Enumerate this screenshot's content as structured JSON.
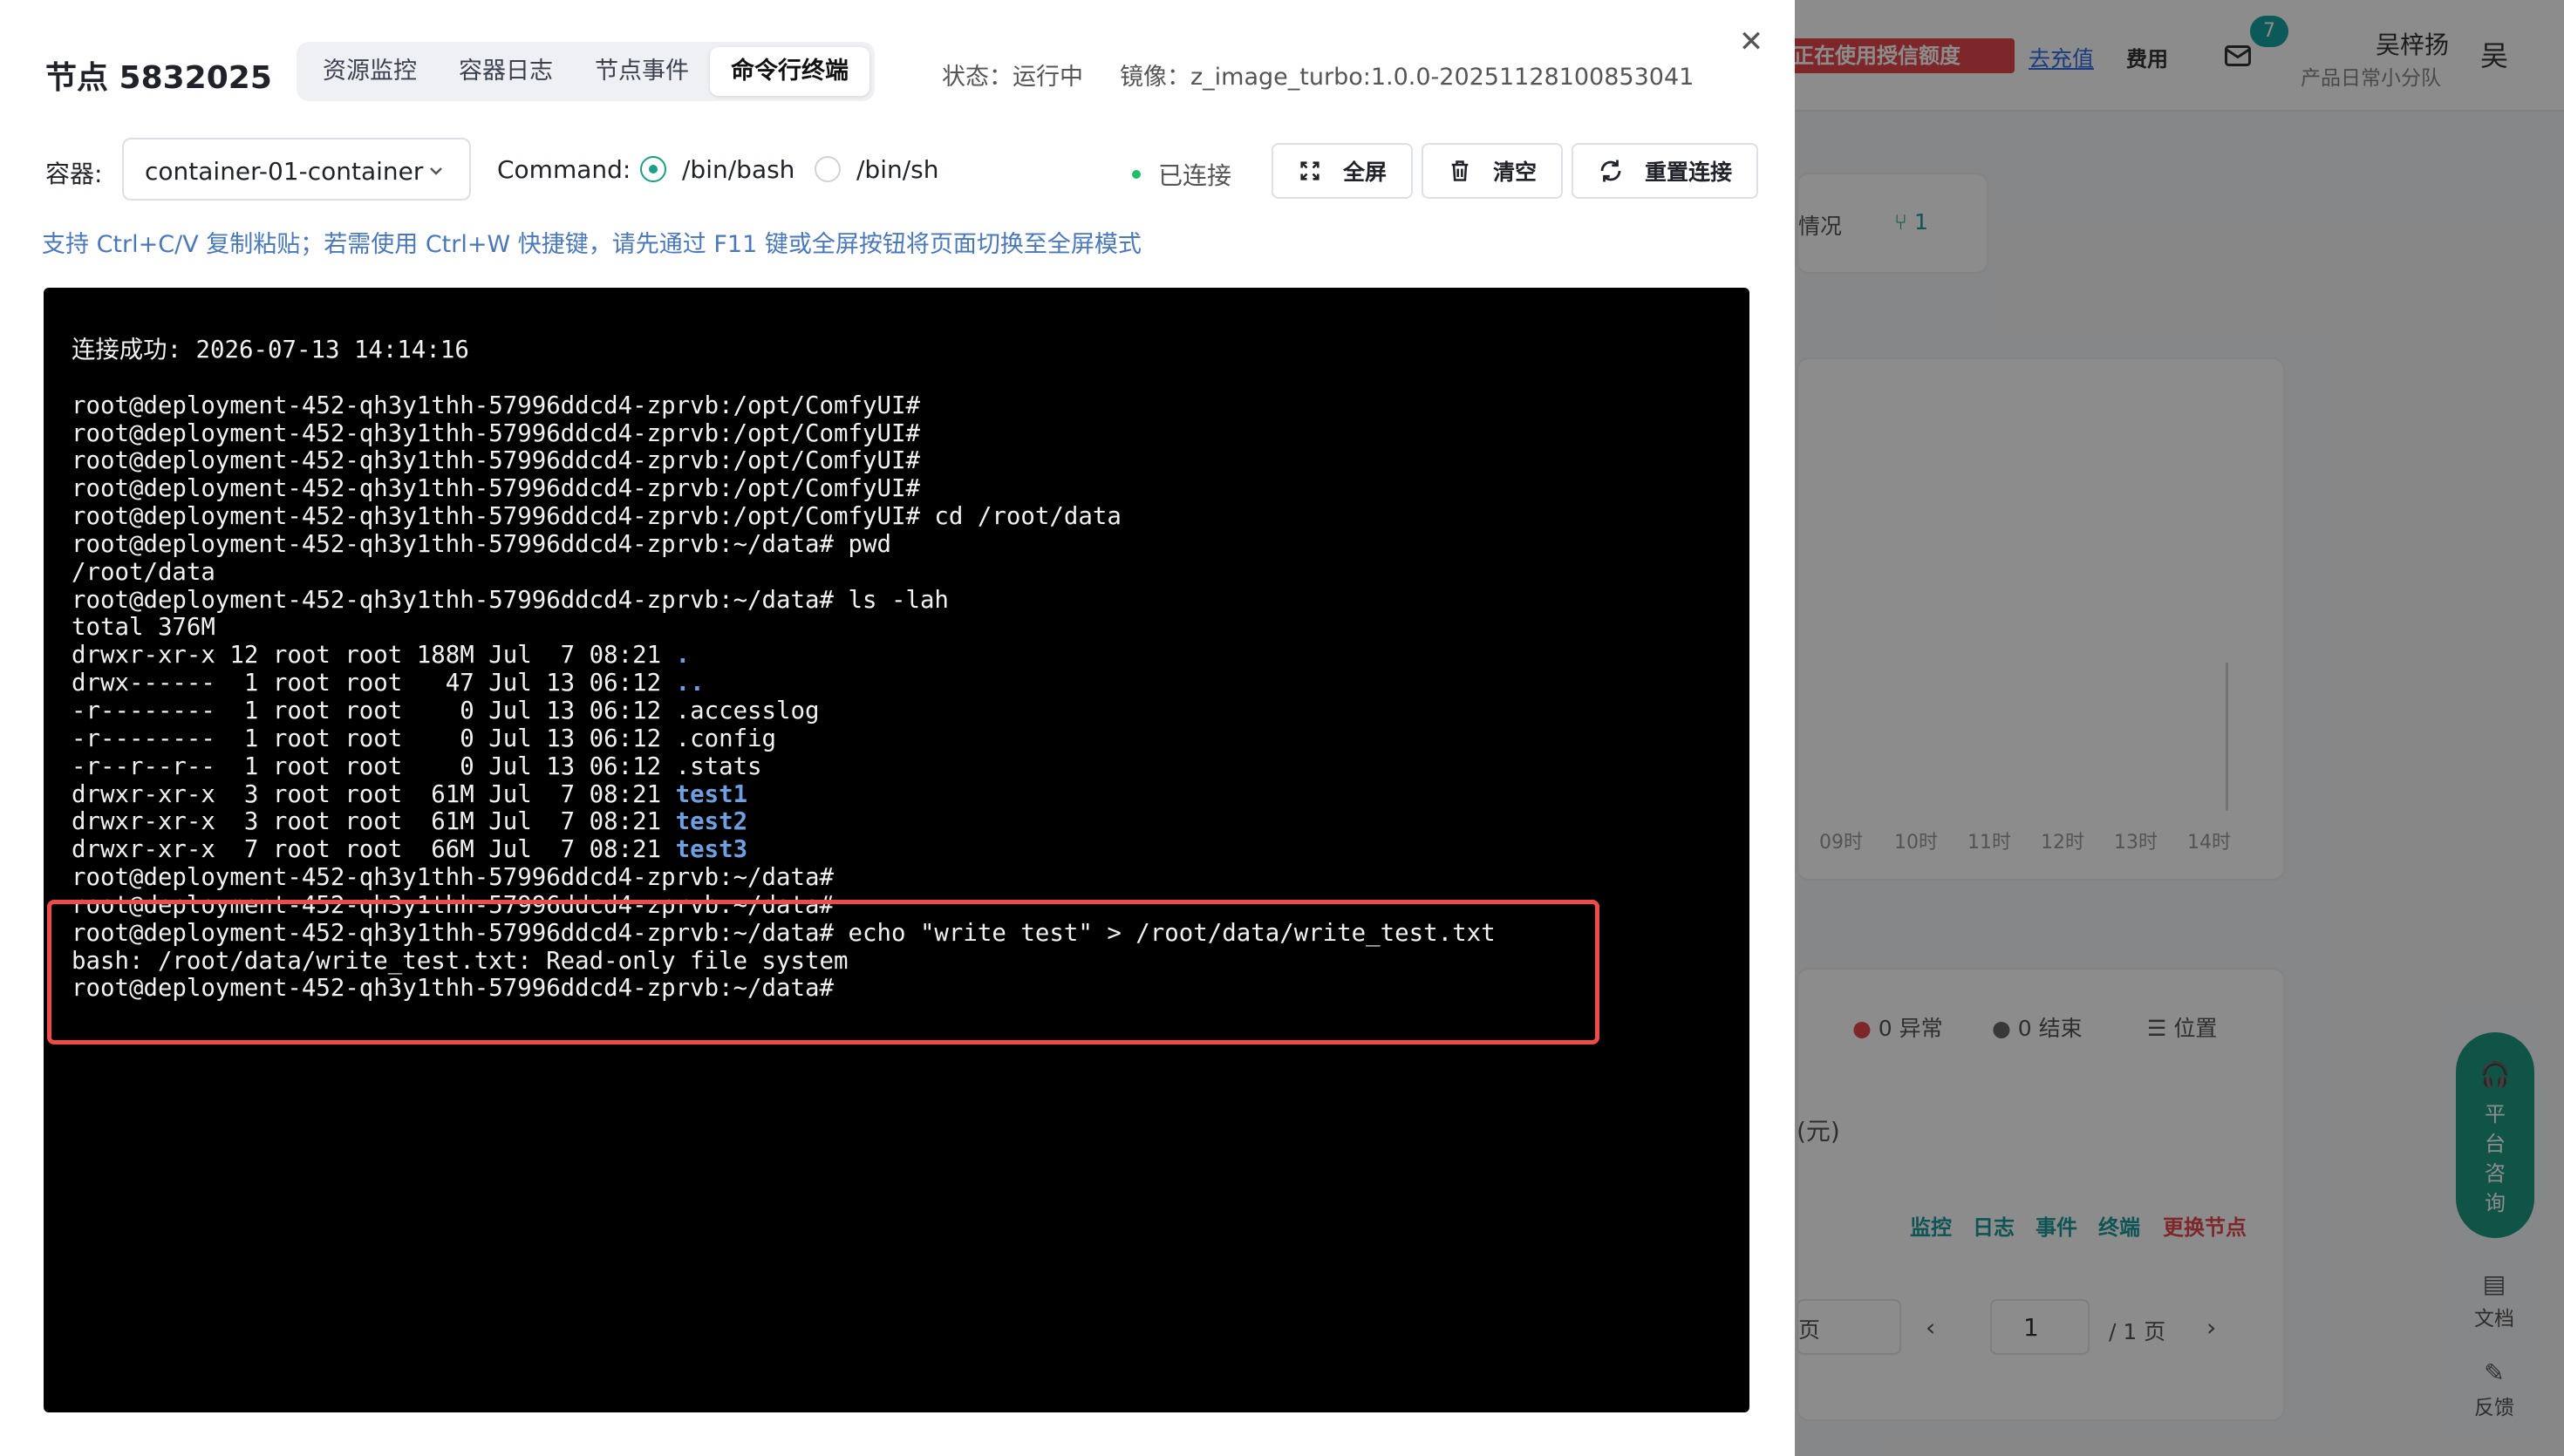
{
  "background": {
    "quota_banner": "正在使用授信额度",
    "recharge_link": "去充值",
    "fee_label": "费用",
    "mail_badge": "7",
    "user_name": "吴梓扬",
    "team_name": "产品日常小分队",
    "avatar_char": "吴",
    "card_overview": "情况",
    "card_count": "1",
    "chart_ticks": [
      "09时",
      "10时",
      "11时",
      "12时",
      "13时",
      "14时"
    ],
    "chip_abnormal": "0 异常",
    "chip_ended": "0 结束",
    "chip_position": "位置",
    "unit_yuan": "(元)",
    "row_links": [
      "监控",
      "日志",
      "事件",
      "终端"
    ],
    "row_link_danger": "更换节点",
    "pager_page": "1",
    "pager_total": "/ 1 页",
    "pager_size": "页",
    "consult": "平台咨询",
    "docs": "文档",
    "feedback": "反馈"
  },
  "drawer": {
    "title": "节点 5832025",
    "tabs": [
      {
        "label": "资源监控"
      },
      {
        "label": "容器日志"
      },
      {
        "label": "节点事件"
      },
      {
        "label": "命令行终端"
      }
    ],
    "active_tab": "命令行终端",
    "status": "状态：运行中",
    "image": "镜像：z_image_turbo:1.0.0-20251128100853041",
    "container_label": "容器:",
    "container_value": "container-01-container",
    "command_label": "Command:",
    "shell_options": [
      {
        "label": "/bin/bash",
        "selected": true
      },
      {
        "label": "/bin/sh",
        "selected": false
      }
    ],
    "connection": "已连接",
    "buttons": {
      "fullscreen": "全屏",
      "clear": "清空",
      "reconnect": "重置连接"
    },
    "hint": "支持 Ctrl+C/V 复制粘贴；若需使用 Ctrl+W 快捷键，请先通过 F11 键或全屏按钮将页面切换至全屏模式",
    "accent_color": "#1a9e8a",
    "highlight_color": "#ee4b4b"
  },
  "terminal": {
    "lines": [
      {
        "text": "连接成功: 2026-07-13 14:14:16"
      },
      {
        "text": ""
      },
      {
        "text": "root@deployment-452-qh3y1thh-57996ddcd4-zprvb:/opt/ComfyUI#"
      },
      {
        "text": "root@deployment-452-qh3y1thh-57996ddcd4-zprvb:/opt/ComfyUI#"
      },
      {
        "text": "root@deployment-452-qh3y1thh-57996ddcd4-zprvb:/opt/ComfyUI#"
      },
      {
        "text": "root@deployment-452-qh3y1thh-57996ddcd4-zprvb:/opt/ComfyUI#"
      },
      {
        "text": "root@deployment-452-qh3y1thh-57996ddcd4-zprvb:/opt/ComfyUI# cd /root/data"
      },
      {
        "text": "root@deployment-452-qh3y1thh-57996ddcd4-zprvb:~/data# pwd"
      },
      {
        "text": "/root/data"
      },
      {
        "text": "root@deployment-452-qh3y1thh-57996ddcd4-zprvb:~/data# ls -lah"
      },
      {
        "text": "total 376M"
      },
      {
        "text": "drwxr-xr-x 12 root root 188M Jul  7 08:21 ",
        "dir": "."
      },
      {
        "text": "drwx------  1 root root   47 Jul 13 06:12 ",
        "dir": ".."
      },
      {
        "text": "-r--------  1 root root    0 Jul 13 06:12 .accesslog"
      },
      {
        "text": "-r--------  1 root root    0 Jul 13 06:12 .config"
      },
      {
        "text": "-r--r--r--  1 root root    0 Jul 13 06:12 .stats"
      },
      {
        "text": "drwxr-xr-x  3 root root  61M Jul  7 08:21 ",
        "dir": "test1"
      },
      {
        "text": "drwxr-xr-x  3 root root  61M Jul  7 08:21 ",
        "dir": "test2"
      },
      {
        "text": "drwxr-xr-x  7 root root  66M Jul  7 08:21 ",
        "dir": "test3"
      },
      {
        "text": "root@deployment-452-qh3y1thh-57996ddcd4-zprvb:~/data#"
      },
      {
        "text": "root@deployment-452-qh3y1thh-57996ddcd4-zprvb:~/data#"
      },
      {
        "text": "root@deployment-452-qh3y1thh-57996ddcd4-zprvb:~/data# echo \"write test\" > /root/data/write_test.txt"
      },
      {
        "text": "bash: /root/data/write_test.txt: Read-only file system"
      },
      {
        "text": "root@deployment-452-qh3y1thh-57996ddcd4-zprvb:~/data#"
      }
    ]
  }
}
